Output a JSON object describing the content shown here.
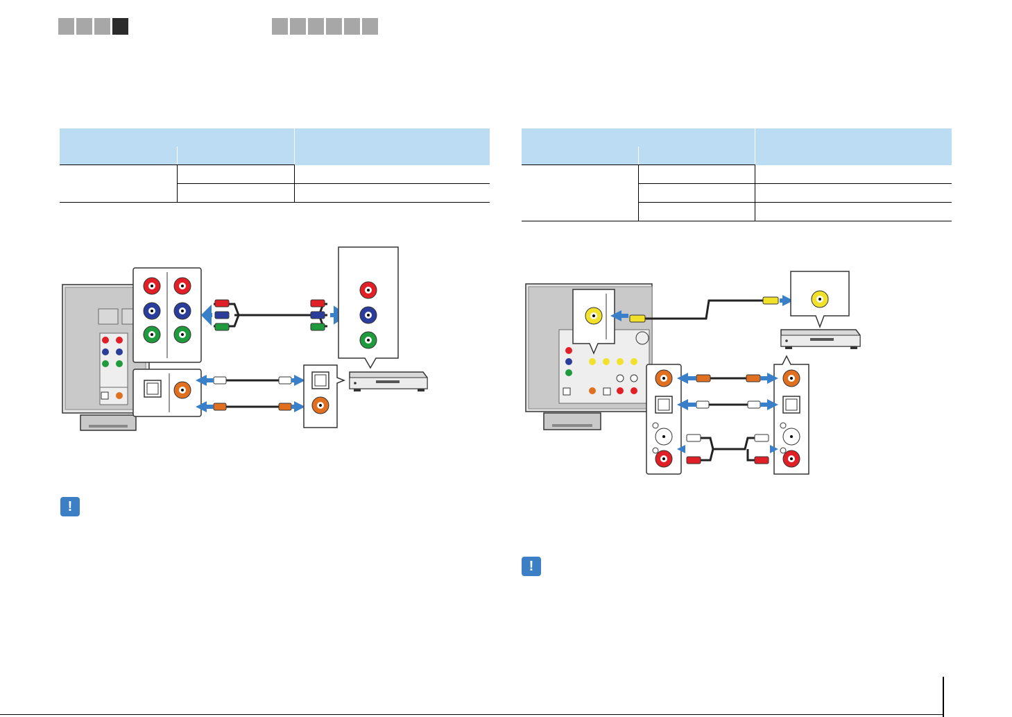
{
  "header": {
    "section_tabs": [
      {
        "name": "tab-1",
        "active": false
      },
      {
        "name": "tab-2",
        "active": false
      },
      {
        "name": "tab-3",
        "active": false
      },
      {
        "name": "tab-4",
        "active": true
      }
    ],
    "chapter_tabs": [
      {
        "name": "chapter-1"
      },
      {
        "name": "chapter-2"
      },
      {
        "name": "chapter-3"
      },
      {
        "name": "chapter-4"
      },
      {
        "name": "chapter-5"
      },
      {
        "name": "chapter-6"
      }
    ],
    "colors": {
      "tab_inactive": "#a7a7a7",
      "tab_active": "#2b2b2b"
    }
  },
  "tables": {
    "left": {
      "header_fill": "#bbdcf2",
      "data_rows": 2
    },
    "right": {
      "header_fill": "#bbdcf2",
      "data_rows": 3
    }
  },
  "diagrams": {
    "component_connection": {
      "cables": [
        "component-video-cable",
        "optical-cable",
        "coaxial-cable"
      ],
      "jacks": [
        "red",
        "blue",
        "green"
      ],
      "colors": {
        "red": "#e01f26",
        "blue": "#2b3d9a",
        "green": "#1f9a3c",
        "orange": "#e07020",
        "arrow": "#3a80c8",
        "panel": "#c9c9c9"
      }
    },
    "composite_connection": {
      "cables": [
        "composite-video-cable",
        "coaxial-cable",
        "optical-cable",
        "stereo-pin-cable"
      ],
      "jacks": [
        "yellow",
        "orange",
        "white",
        "red"
      ],
      "colors": {
        "yellow": "#f2e12a",
        "orange": "#e07020",
        "red": "#e01f26",
        "arrow": "#3a80c8"
      }
    }
  },
  "notes": {
    "left_icon": "caution-icon",
    "right_icon": "caution-icon",
    "icon_glyph": "!",
    "icon_color": "#3d7fc4"
  }
}
